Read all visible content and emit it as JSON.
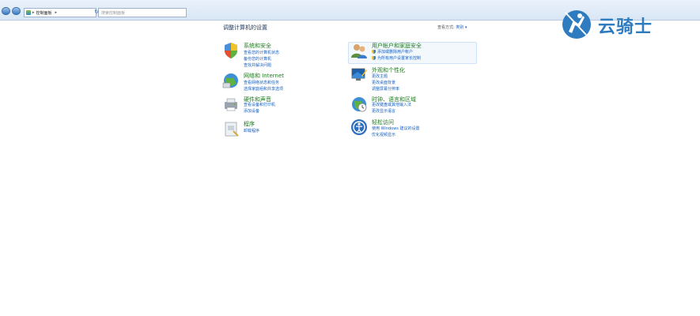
{
  "address_bar": {
    "breadcrumb": "控制面板",
    "search_placeholder": "搜索控制面板",
    "refresh_glyph": "↻"
  },
  "logo": {
    "text": "云骑士"
  },
  "main": {
    "heading": "调整计算机的设置",
    "view_by_label": "查看方式:",
    "view_by_value": "类别 ▾"
  },
  "categories_left": [
    {
      "title": "系统和安全",
      "icon": "system-security-icon",
      "links": [
        "查看您的计算机状态",
        "备份您的计算机",
        "查找并解决问题"
      ]
    },
    {
      "title": "网络和 Internet",
      "icon": "network-icon",
      "links": [
        "查看网络状态和任务",
        "选择家庭组和共享选项"
      ]
    },
    {
      "title": "硬件和声音",
      "icon": "hardware-sound-icon",
      "links": [
        "查看设备和打印机",
        "添加设备"
      ]
    },
    {
      "title": "程序",
      "icon": "programs-icon",
      "links": [
        "卸载程序"
      ]
    }
  ],
  "categories_right": [
    {
      "title": "用户帐户和家庭安全",
      "icon": "user-accounts-icon",
      "links": [
        "添加或删除用户帐户",
        "为所有用户设置家长控制"
      ]
    },
    {
      "title": "外观和个性化",
      "icon": "appearance-icon",
      "links": [
        "更改主题",
        "更改桌面背景",
        "调整屏幕分辨率"
      ]
    },
    {
      "title": "时钟、语言和区域",
      "icon": "clock-language-icon",
      "links": [
        "更改键盘或其他输入法",
        "更改显示语言"
      ]
    },
    {
      "title": "轻松访问",
      "icon": "ease-of-access-icon",
      "links": [
        "使用 Windows 建议的设置",
        "优化视频显示"
      ]
    }
  ],
  "colors": {
    "category_title": "#1e7a1e",
    "link": "#1560c0",
    "heading": "#1e395b",
    "logo": "#2f7bbf"
  }
}
